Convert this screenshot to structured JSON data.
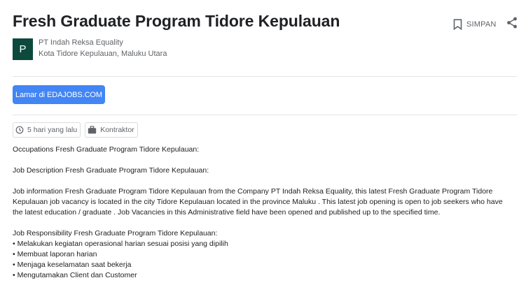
{
  "job": {
    "title": "Fresh Graduate Program Tidore Kepulauan",
    "save_label": "SIMPAN",
    "company_initial": "P",
    "company_name": "PT Indah Reksa Equality",
    "location": "Kota Tidore Kepulauan, Maluku Utara",
    "apply_label": "Lamar di EDAJOBS.COM",
    "posted": "5 hari yang lalu",
    "employment_type": "Kontraktor"
  },
  "description": {
    "occupations": "Occupations Fresh Graduate Program Tidore Kepulauan:",
    "job_description_heading": "Job Description Fresh Graduate Program Tidore Kepulauan:",
    "info_paragraph": "Job information Fresh Graduate Program Tidore Kepulauan from the Company PT Indah Reksa Equality, this latest Fresh Graduate Program Tidore Kepulauan job vacancy is located in the city Tidore Kepulauan located in the province Maluku . This latest job opening is open to job seekers who have the latest education / graduate . Job Vacancies in this Administrative field have been opened and published up to the specified time.",
    "responsibility_heading": "Job Responsibility Fresh Graduate Program Tidore Kepulauan:",
    "responsibilities": [
      "Melakukan kegiatan operasional harian sesuai posisi yang dipilih",
      "Membuat laporan harian",
      "Menjaga keselamatan saat bekerja",
      "Mengutamakan Client dan Customer"
    ]
  },
  "colors": {
    "apply_button": "#4285f4",
    "logo_background": "#0d4a3d"
  },
  "icons": {
    "save": "bookmark-icon",
    "share": "share-icon",
    "posted": "clock-icon",
    "employment_type": "briefcase-icon"
  }
}
